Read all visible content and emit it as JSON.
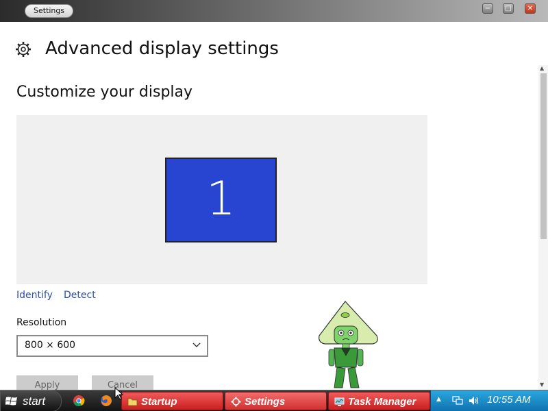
{
  "window": {
    "title": "Settings",
    "controls": {
      "minimize": "−",
      "maximize": "□",
      "close": "✕"
    }
  },
  "header": {
    "icon": "gear-icon",
    "title": "Advanced display settings"
  },
  "section": {
    "title": "Customize your display"
  },
  "display_preview": {
    "monitor_label": "1",
    "monitor_color": "#2745d0"
  },
  "links": {
    "identify": "Identify",
    "detect": "Detect"
  },
  "resolution": {
    "label": "Resolution",
    "value": "800 × 600"
  },
  "buttons": {
    "apply": "Apply",
    "cancel": "Cancel"
  },
  "taskbar": {
    "start_label": "start",
    "quicklaunch": [
      "chrome-icon",
      "firefox-icon"
    ],
    "tasks": [
      {
        "label": "Startup",
        "icon": "folder-icon"
      },
      {
        "label": "Settings",
        "icon": "gear-icon"
      },
      {
        "label": "Task Manager",
        "icon": "monitor-icon"
      }
    ],
    "clock": "10:55 AM"
  },
  "colors": {
    "accent_link": "#2c4fa8",
    "taskbar_task": "#d13030",
    "tray": "#1a8ccc"
  }
}
